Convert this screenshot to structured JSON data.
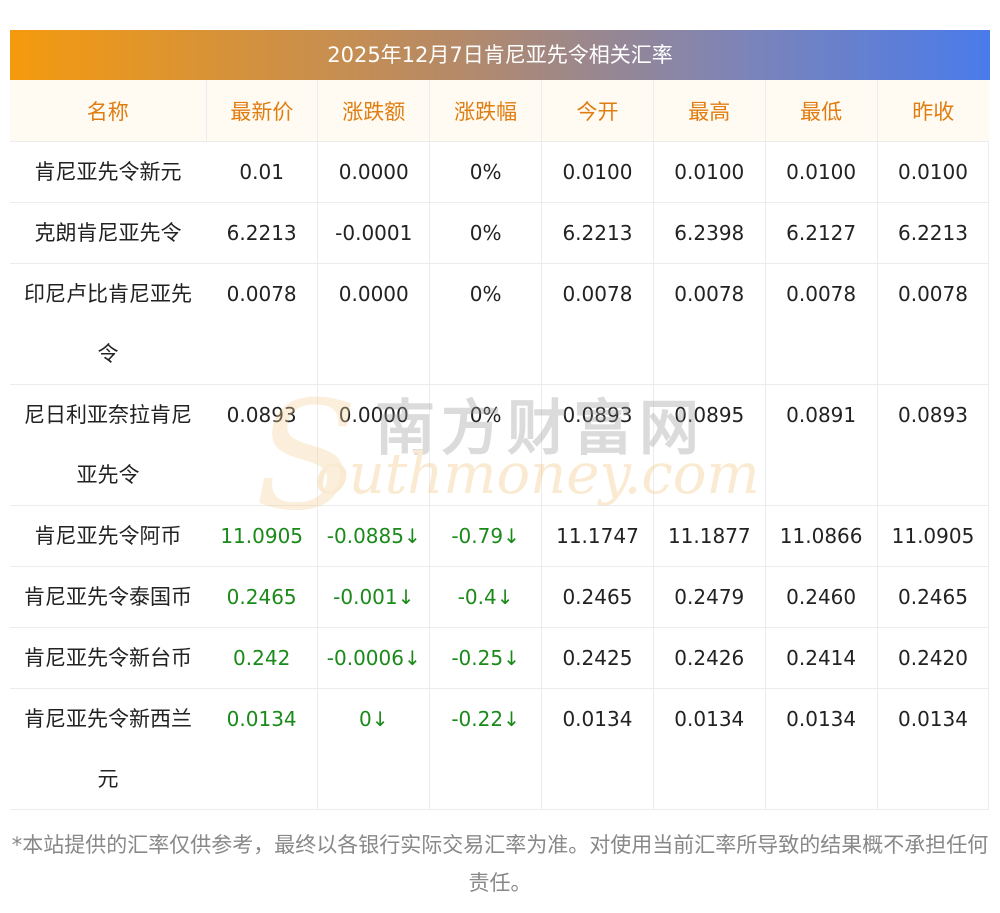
{
  "title": "2025年12月7日肯尼亚先令相关汇率",
  "headers": [
    "名称",
    "最新价",
    "涨跌额",
    "涨跌幅",
    "今开",
    "最高",
    "最低",
    "昨收"
  ],
  "rows": [
    {
      "name": "肯尼亚先令新元",
      "latest": "0.01",
      "change": "0.0000",
      "pct": "0%",
      "open": "0.0100",
      "high": "0.0100",
      "low": "0.0100",
      "prev": "0.0100"
    },
    {
      "name": "克朗肯尼亚先令",
      "latest": "6.2213",
      "change": "-0.0001",
      "pct": "0%",
      "open": "6.2213",
      "high": "6.2398",
      "low": "6.2127",
      "prev": "6.2213"
    },
    {
      "name": "印尼卢比肯尼亚先令",
      "latest": "0.0078",
      "change": "0.0000",
      "pct": "0%",
      "open": "0.0078",
      "high": "0.0078",
      "low": "0.0078",
      "prev": "0.0078"
    },
    {
      "name": "尼日利亚奈拉肯尼亚先令",
      "latest": "0.0893",
      "change": "0.0000",
      "pct": "0%",
      "open": "0.0893",
      "high": "0.0895",
      "low": "0.0891",
      "prev": "0.0893"
    },
    {
      "name": "肯尼亚先令阿币",
      "latest": "11.0905",
      "change": "-0.0885↓",
      "pct": "-0.79↓",
      "open": "11.1747",
      "high": "11.1877",
      "low": "11.0866",
      "prev": "11.0905"
    },
    {
      "name": "肯尼亚先令泰国币",
      "latest": "0.2465",
      "change": "-0.001↓",
      "pct": "-0.4↓",
      "open": "0.2465",
      "high": "0.2479",
      "low": "0.2460",
      "prev": "0.2465"
    },
    {
      "name": "肯尼亚先令新台币",
      "latest": "0.242",
      "change": "-0.0006↓",
      "pct": "-0.25↓",
      "open": "0.2425",
      "high": "0.2426",
      "low": "0.2414",
      "prev": "0.2420"
    },
    {
      "name": "肯尼亚先令新西兰元",
      "latest": "0.0134",
      "change": "0↓",
      "pct": "-0.22↓",
      "open": "0.0134",
      "high": "0.0134",
      "low": "0.0134",
      "prev": "0.0134"
    }
  ],
  "watermark": {
    "cn": "南方财富网",
    "en": "outhmoney.com",
    "letter": "S"
  },
  "footnote": "*本站提供的汇率仅供参考，最终以各银行实际交易汇率为准。对使用当前汇率所导致的结果概不承担任何责任。"
}
